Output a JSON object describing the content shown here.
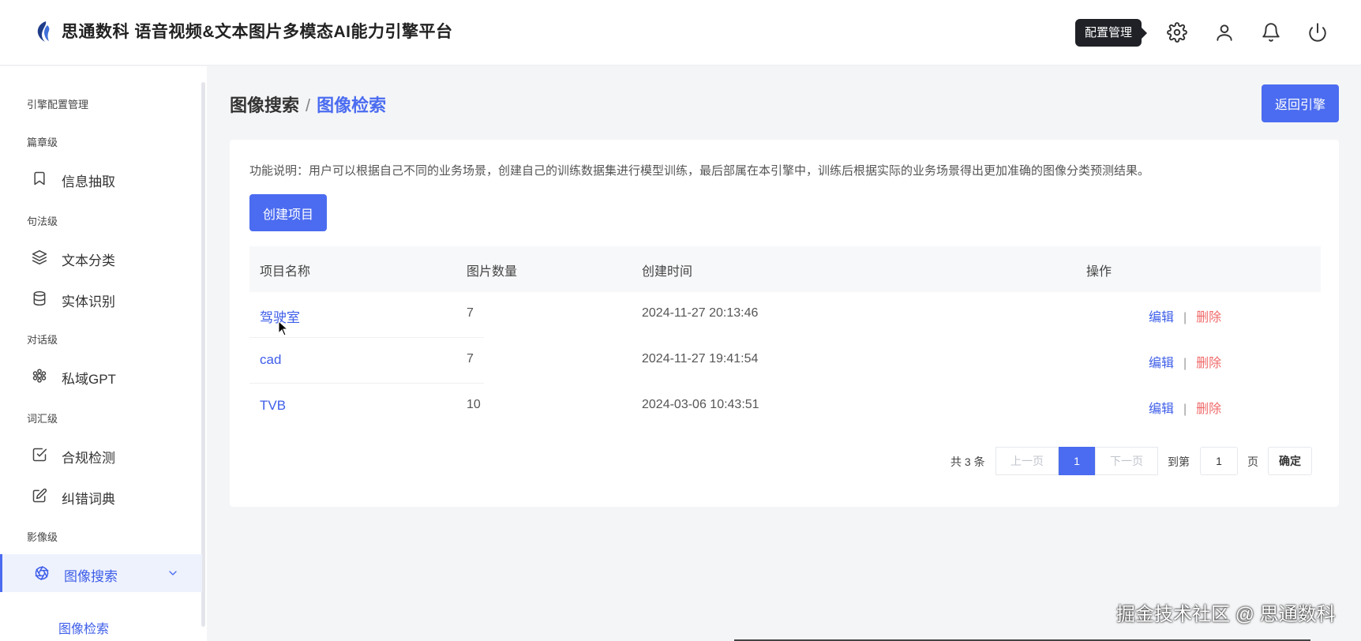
{
  "header": {
    "app_title": "思通数科 语音视频&文本图片多模态AI能力引擎平台",
    "tooltip": "配置管理",
    "icons": [
      "gear-icon",
      "user-icon",
      "bell-icon",
      "power-icon"
    ]
  },
  "sidebar": {
    "section_title": "引擎配置管理",
    "groups": [
      {
        "title": "篇章级",
        "items": [
          {
            "label": "信息抽取",
            "icon": "bookmark-icon"
          }
        ]
      },
      {
        "title": "句法级",
        "items": [
          {
            "label": "文本分类",
            "icon": "layers-icon"
          },
          {
            "label": "实体识别",
            "icon": "database-icon"
          }
        ]
      },
      {
        "title": "对话级",
        "items": [
          {
            "label": "私域GPT",
            "icon": "gpt-icon"
          }
        ]
      },
      {
        "title": "词汇级",
        "items": [
          {
            "label": "合规检测",
            "icon": "check-square-icon"
          },
          {
            "label": "纠错词典",
            "icon": "edit-icon"
          }
        ]
      },
      {
        "title": "影像级",
        "items": [
          {
            "label": "图像搜索",
            "icon": "aperture-icon",
            "active": true
          }
        ]
      }
    ],
    "sub_item": "图像检索"
  },
  "main": {
    "breadcrumb": {
      "parent": "图像搜索",
      "separator": "/",
      "current": "图像检索"
    },
    "back_button": "返回引擎",
    "description": "功能说明：用户可以根据自己不同的业务场景，创建自己的训练数据集进行模型训练，最后部属在本引擎中，训练后根据实际的业务场景得出更加准确的图像分类预测结果。",
    "create_button": "创建项目",
    "table": {
      "columns": [
        "项目名称",
        "图片数量",
        "创建时间",
        "操作"
      ],
      "rows": [
        {
          "name": "驾驶室",
          "count": "7",
          "created": "2024-11-27 20:13:46",
          "edit": "编辑",
          "divider": "|",
          "delete": "删除"
        },
        {
          "name": "cad",
          "count": "7",
          "created": "2024-11-27 19:41:54",
          "edit": "编辑",
          "divider": "|",
          "delete": "删除"
        },
        {
          "name": "TVB",
          "count": "10",
          "created": "2024-03-06 10:43:51",
          "edit": "编辑",
          "divider": "|",
          "delete": "删除"
        }
      ]
    },
    "pagination": {
      "total": "共 3 条",
      "prev": "上一页",
      "current_page": "1",
      "next": "下一页",
      "goto_label": "到第",
      "goto_value": "1",
      "page_unit": "页",
      "confirm": "确定"
    }
  },
  "watermark": "掘金技术社区 @ 思通数科",
  "colors": {
    "accent": "#4b6cf0",
    "danger": "#f06a6a",
    "background": "#f4f5f7"
  }
}
